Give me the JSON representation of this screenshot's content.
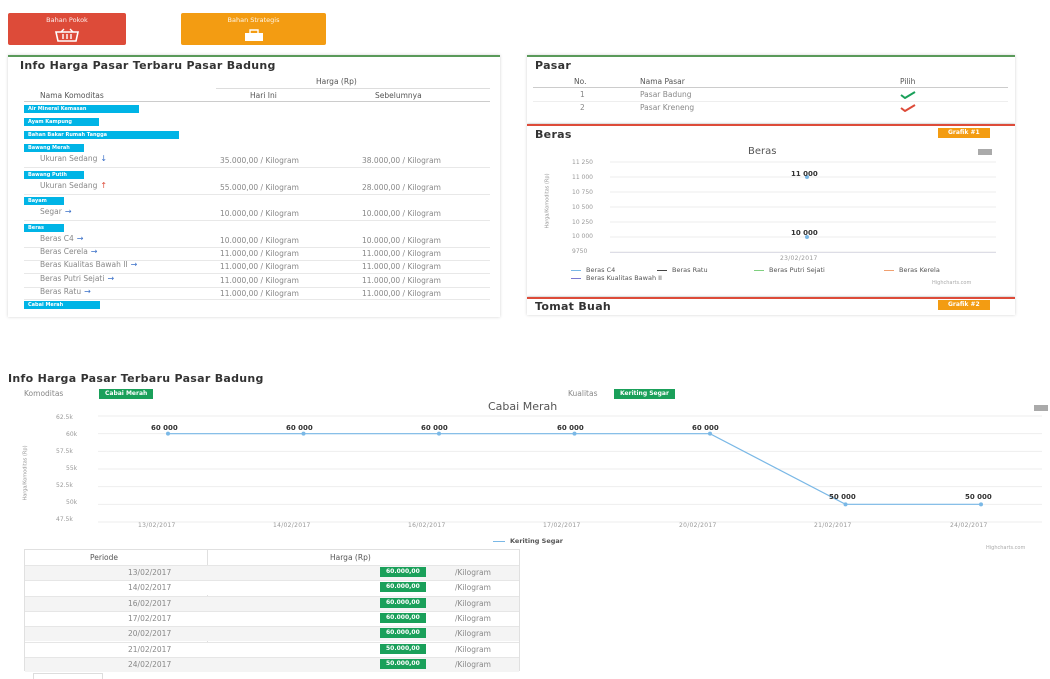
{
  "top_buttons": {
    "left_label": "Bahan Pokok",
    "right_label": "Bahan Strategis"
  },
  "colors": {
    "red": "#dd4b39",
    "orange": "#f39c12",
    "cyan": "#00b4e6",
    "green": "#1aa05a",
    "line": "#7ab8e6"
  },
  "info_panel": {
    "title": "Info Harga Pasar Terbaru Pasar Badung",
    "col_group": "Harga (Rp)",
    "col_komoditas": "Nama Komoditas",
    "col_hari_ini": "Hari Ini",
    "col_sebelumnya": "Sebelumnya",
    "categories": [
      "Air Mineral Kemasan",
      "Ayam Kampung",
      "Bahan Bakar Rumah Tangga",
      "Bawang Merah",
      "Bawang Putih",
      "Bayam",
      "Beras",
      "Cabai Merah"
    ],
    "rows": [
      {
        "name": "Ukuran Sedang",
        "trend": "down",
        "today": "35.000,00 / Kilogram",
        "before": "38.000,00 / Kilogram"
      },
      {
        "name": "Ukuran Sedang",
        "trend": "up",
        "today": "55.000,00 / Kilogram",
        "before": "28.000,00 / Kilogram"
      },
      {
        "name": "Segar",
        "trend": "flat",
        "today": "10.000,00 / Kilogram",
        "before": "10.000,00 / Kilogram"
      },
      {
        "name": "Beras C4",
        "trend": "flat",
        "today": "10.000,00 / Kilogram",
        "before": "10.000,00 / Kilogram"
      },
      {
        "name": "Beras Cerela",
        "trend": "flat",
        "today": "11.000,00 / Kilogram",
        "before": "11.000,00 / Kilogram"
      },
      {
        "name": "Beras Kualitas Bawah II",
        "trend": "flat",
        "today": "11.000,00 / Kilogram",
        "before": "11.000,00 / Kilogram"
      },
      {
        "name": "Beras Putri Sejati",
        "trend": "flat",
        "today": "11.000,00 / Kilogram",
        "before": "11.000,00 / Kilogram"
      },
      {
        "name": "Beras Ratu",
        "trend": "flat",
        "today": "11.000,00 / Kilogram",
        "before": "11.000,00 / Kilogram"
      }
    ]
  },
  "pasar_panel": {
    "title": "Pasar",
    "col_no": "No.",
    "col_nama": "Nama Pasar",
    "col_pilih": "Pilih",
    "rows": [
      {
        "no": "1",
        "nama": "Pasar Badung",
        "pilih": "check"
      },
      {
        "no": "2",
        "nama": "Pasar Kreneng",
        "pilih": "check"
      }
    ]
  },
  "beras_panel": {
    "title": "Beras",
    "grafik_label": "Grafik #1",
    "chart_title": "Beras",
    "yaxis_label": "Harga/Komoditas (Rp)",
    "credit": "Highcharts.com",
    "legend": [
      "Beras C4",
      "Beras Ratu",
      "Beras Putri Sejati",
      "Beras Kerela",
      "Beras Kualitas Bawah II"
    ]
  },
  "tomat_panel": {
    "title": "Tomat Buah",
    "grafik_label": "Grafik #2"
  },
  "bottom": {
    "title": "Info Harga Pasar Terbaru Pasar Badung",
    "komoditas_label": "Komoditas",
    "komoditas_value": "Cabai Merah",
    "kualitas_label": "Kualitas",
    "kualitas_value": "Keriting Segar",
    "yaxis_label": "Harga/Komoditas (Rp)",
    "credit": "Highcharts.com",
    "table_col_periode": "Periode",
    "table_col_harga": "Harga (Rp)",
    "table_unit": "/Kilogram",
    "table_rows": [
      {
        "periode": "13/02/2017",
        "harga": "60.000,00"
      },
      {
        "periode": "14/02/2017",
        "harga": "60.000,00"
      },
      {
        "periode": "16/02/2017",
        "harga": "60.000,00"
      },
      {
        "periode": "17/02/2017",
        "harga": "60.000,00"
      },
      {
        "periode": "20/02/2017",
        "harga": "60.000,00"
      },
      {
        "periode": "21/02/2017",
        "harga": "50.000,00"
      },
      {
        "periode": "24/02/2017",
        "harga": "50.000,00"
      }
    ]
  },
  "chart_data": [
    {
      "type": "line",
      "title": "Beras",
      "ylabel": "Harga/Komoditas (Rp)",
      "yticks": [
        "11 250",
        "11 000",
        "10 750",
        "10 500",
        "10 250",
        "10 000",
        "9750"
      ],
      "ylim": [
        9750,
        11250
      ],
      "x": [
        "23/02/2017"
      ],
      "series": [
        {
          "name": "Beras C4",
          "values": [
            10000
          ]
        },
        {
          "name": "Beras Ratu",
          "values": [
            11000
          ]
        },
        {
          "name": "Beras Putri Sejati",
          "values": [
            11000
          ]
        },
        {
          "name": "Beras Kerela",
          "values": [
            11000
          ]
        },
        {
          "name": "Beras Kualitas Bawah II",
          "values": [
            11000
          ]
        }
      ],
      "data_labels": [
        "11 000",
        "10 000"
      ],
      "legend_position": "bottom"
    },
    {
      "type": "line",
      "title": "Cabai Merah",
      "ylabel": "Harga/Komoditas (Rp)",
      "yticks": [
        "62.5k",
        "60k",
        "57.5k",
        "55k",
        "52.5k",
        "50k",
        "47.5k"
      ],
      "ylim": [
        47500,
        62500
      ],
      "x": [
        "13/02/2017",
        "14/02/2017",
        "16/02/2017",
        "17/02/2017",
        "20/02/2017",
        "21/02/2017",
        "24/02/2017"
      ],
      "series": [
        {
          "name": "Keriting Segar",
          "values": [
            60000,
            60000,
            60000,
            60000,
            60000,
            50000,
            50000
          ]
        }
      ],
      "data_labels": [
        "60 000",
        "60 000",
        "60 000",
        "60 000",
        "60 000",
        "50 000",
        "50 000"
      ],
      "legend_position": "bottom"
    }
  ]
}
